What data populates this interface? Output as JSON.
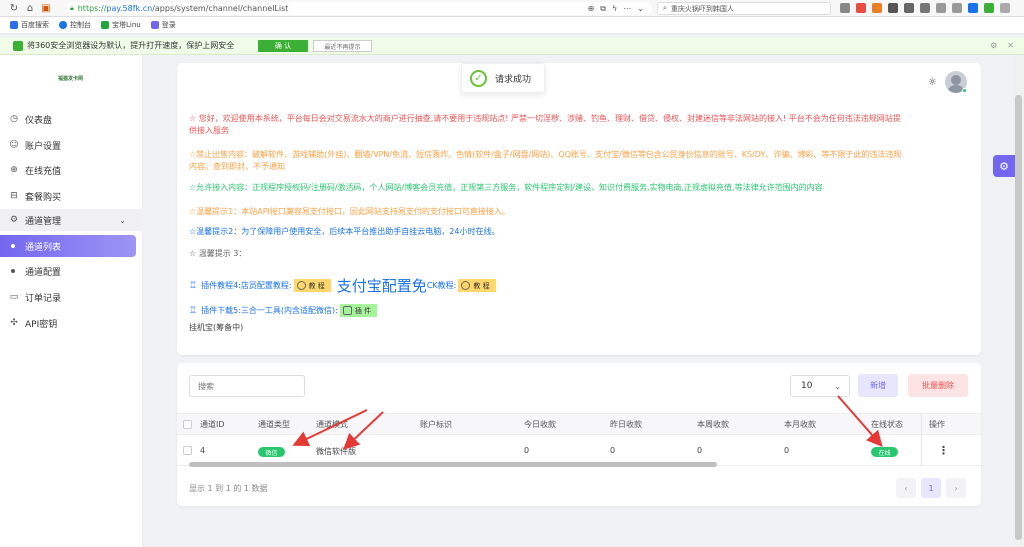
{
  "browser": {
    "url_prefix": "https://",
    "url_host": "pay.58fk.cn",
    "url_path": "/apps/system/channel/channelList",
    "search_text": "重庆火锅吓到韩国人",
    "bookmarks": [
      {
        "label": "百度搜索",
        "color": "#2a6ee8"
      },
      {
        "label": "控制台",
        "color": "#1a73e8"
      },
      {
        "label": "宝塔Linu",
        "color": "#20a53a"
      },
      {
        "label": "登录",
        "color": "#7367f0"
      }
    ],
    "notice_text": "将360安全浏览器设为默认，提升打开速度，保护上网安全",
    "notice_confirm": "确 认",
    "notice_dismiss": "最近不再提示"
  },
  "sidebar": {
    "logo": "福猫发卡网",
    "items": [
      {
        "label": "仪表盘",
        "icon": "◷"
      },
      {
        "label": "账户设置",
        "icon": "☺"
      },
      {
        "label": "在线充值",
        "icon": "⊕"
      },
      {
        "label": "套餐购买",
        "icon": "⊟"
      },
      {
        "label": "通道管理",
        "icon": "⚙"
      },
      {
        "label": "通道列表"
      },
      {
        "label": "通道配置"
      },
      {
        "label": "订单记录",
        "icon": "▭"
      },
      {
        "label": "API密钥",
        "icon": "✣"
      }
    ]
  },
  "toast": {
    "text": "请求成功"
  },
  "notices": {
    "line1a": "☆ 您好，欢迎使用本系统，平台每日会对交易流水大的商户进行抽查,请不要用于违规站点! 严禁一切淫秽、涉赌、钓鱼、理财、借贷、侵权、封建迷信等非法网站的接入! 平台不会为任何违法违规网站提",
    "line1b": "供接入服务",
    "line2a": "☆禁止出售内容：破解软件、游戏辅助(外挂)、翻墙/VPN/免流、短信轰炸、色情(软件/盒子/网盘/网站)、QQ账号、支付宝/微信等包含公民身份信息的账号、KS/DY、诈骗、博彩、等不限于此的违法违规",
    "line2b": "内容。查到即封，不予通知",
    "line3": "☆允许接入内容：正规程序授权码/注册码/激活码，个人网站/博客会员充值，正规第三方服务，软件程序定制/建设，知识付费服务,实物电商,正规虚拟充值,等法律允许范围内的内容",
    "line4": "☆温馨提示1：本站API接口兼容易支付接口，因此网站支持易支付的支付接口可直接接入。",
    "line5": "☆温馨提示2：为了保障用户使用安全，后续本平台推出助手自挂云电脑，24小时在线。",
    "line6": "☆ 温馨提示 3："
  },
  "plugins": {
    "row1_label": "插件教程4:店员配置教程:",
    "row1_tag": "教 程",
    "row1_big": "支付宝配置免",
    "row1_suffix": "CK教程:",
    "row1_tag2": "教 程",
    "row2_label": "插件下载5:三合一工具(内含适配微信):",
    "row2_tag": "插 件",
    "hang_text": "挂机宝(筹备中)"
  },
  "toolbar": {
    "search_placeholder": "搜索",
    "page_size": "10",
    "add_label": "新增",
    "delete_label": "批量删除"
  },
  "table": {
    "headers": [
      "通道ID",
      "通道类型",
      "通道模式",
      "账户标识",
      "今日收款",
      "昨日收款",
      "本周收款",
      "本月收款",
      "在线状态",
      "操作"
    ],
    "rows": [
      {
        "id": "4",
        "type": "微信",
        "mode": "微信软件版",
        "account": "",
        "today": "0",
        "yesterday": "0",
        "week": "0",
        "month": "0",
        "status": "在线"
      }
    ]
  },
  "footer": {
    "info": "显示 1 到 1 的 1 数据",
    "prev": "‹",
    "page": "1",
    "next": "›"
  },
  "colors": {
    "accent": "#7367f0",
    "success": "#28c76f",
    "danger": "#ea5455",
    "warning": "#ff9f43",
    "info": "#1a73e8"
  }
}
